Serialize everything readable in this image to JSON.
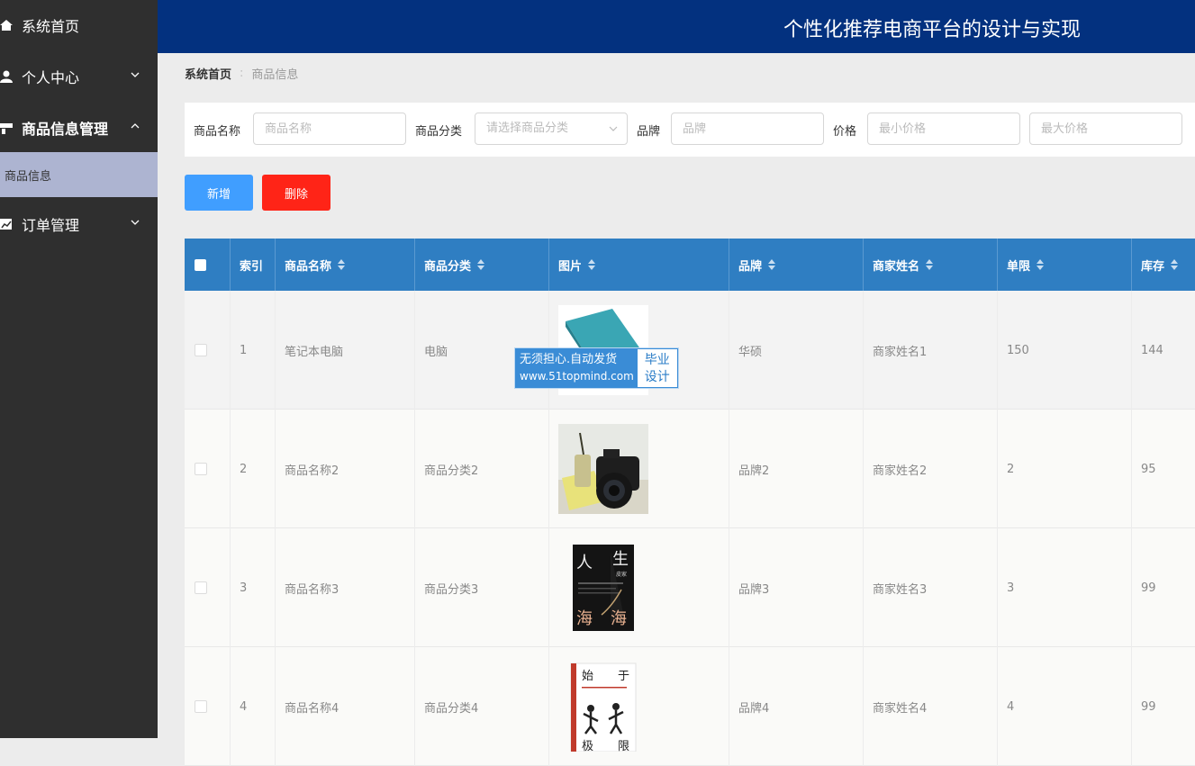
{
  "app": {
    "title": "个性化推荐电商平台的设计与实现"
  },
  "sidebar": {
    "home": "系统首页",
    "personal": "个人中心",
    "goods_mgmt": "商品信息管理",
    "goods_info": "商品信息",
    "orders": "订单管理"
  },
  "breadcrumb": {
    "home": "系统首页",
    "current": "商品信息"
  },
  "search": {
    "name_label": "商品名称",
    "name_placeholder": "商品名称",
    "category_label": "商品分类",
    "category_placeholder": "请选择商品分类",
    "brand_label": "品牌",
    "brand_placeholder": "品牌",
    "price_label": "价格",
    "min_price_placeholder": "最小价格",
    "max_price_placeholder": "最大价格"
  },
  "actions": {
    "add": "新增",
    "delete": "删除"
  },
  "table": {
    "headers": [
      "索引",
      "商品名称",
      "商品分类",
      "图片",
      "品牌",
      "商家姓名",
      "单限",
      "库存"
    ],
    "rows": [
      {
        "index": "1",
        "name": "笔记本电脑",
        "category": "电脑",
        "image": "teal-notebook",
        "brand": "华硕",
        "merchant": "商家姓名1",
        "limit": "150",
        "stock": "144"
      },
      {
        "index": "2",
        "name": "商品名称2",
        "category": "商品分类2",
        "image": "camera-photo",
        "brand": "品牌2",
        "merchant": "商家姓名2",
        "limit": "2",
        "stock": "95"
      },
      {
        "index": "3",
        "name": "商品名称3",
        "category": "商品分类3",
        "image": "book-cover-renshenghai",
        "brand": "品牌3",
        "merchant": "商家姓名3",
        "limit": "3",
        "stock": "99"
      },
      {
        "index": "4",
        "name": "商品名称4",
        "category": "商品分类4",
        "image": "book-cover-shiyujixian",
        "brand": "品牌4",
        "merchant": "商家姓名4",
        "limit": "4",
        "stock": "99"
      }
    ]
  },
  "images": {
    "book3": {
      "big1": "人",
      "big2": "生",
      "big3": "海",
      "big4": "海",
      "small": "皮家"
    },
    "book4": {
      "c1": "始",
      "c2": "于",
      "c3": "极",
      "c4": "限"
    }
  },
  "watermark": {
    "line1": "无须担心.自动发货",
    "line2": "www.51topmind.com",
    "tag1": "毕业",
    "tag2": "设计"
  },
  "colors": {
    "sidebar_bg": "#2f2f2f",
    "header_bg": "#03317f",
    "table_header_bg": "#2f7ec2",
    "active_menu_bg": "#adb4d1",
    "add_button": "#409eff",
    "delete_button": "#ff2417"
  }
}
